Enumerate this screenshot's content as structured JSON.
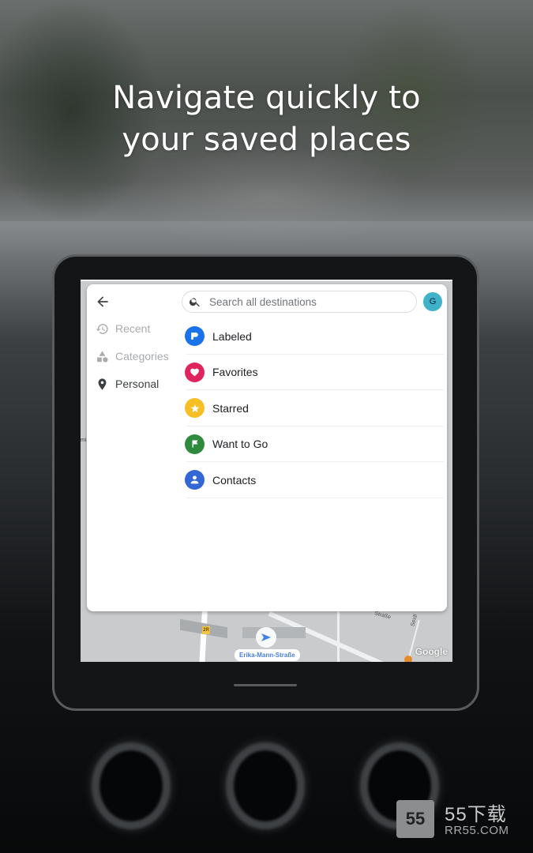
{
  "headline": {
    "line1": "Navigate quickly to",
    "line2": "your saved places"
  },
  "sidebar": {
    "back_icon": "arrow-left-icon",
    "items": [
      {
        "label": "Recent",
        "icon": "history-icon",
        "active": false
      },
      {
        "label": "Categories",
        "icon": "shapes-icon",
        "active": false
      },
      {
        "label": "Personal",
        "icon": "place-pin-icon",
        "active": true
      }
    ]
  },
  "search": {
    "placeholder": "Search all destinations",
    "value": "",
    "icon": "search-icon"
  },
  "account": {
    "avatar_letter": "G",
    "color": "#3fb1c9"
  },
  "saved_lists": [
    {
      "label": "Labeled",
      "icon": "label-flag-icon",
      "color": "#1a73e8"
    },
    {
      "label": "Favorites",
      "icon": "heart-icon",
      "color": "#e0245e"
    },
    {
      "label": "Starred",
      "icon": "star-icon",
      "color": "#f6bf26"
    },
    {
      "label": "Want to Go",
      "icon": "flag-icon",
      "color": "#2e8b3e"
    },
    {
      "label": "Contacts",
      "icon": "person-icon",
      "color": "#3367d6"
    }
  ],
  "map": {
    "current_street": "Erika-Mann-Straße",
    "road_shield": "2R",
    "street_labels": [
      "Straße",
      "Seidl"
    ],
    "attribution": "Google"
  },
  "watermark": {
    "logo_text": "55",
    "brand": "55下载",
    "domain": "RR55.COM"
  }
}
